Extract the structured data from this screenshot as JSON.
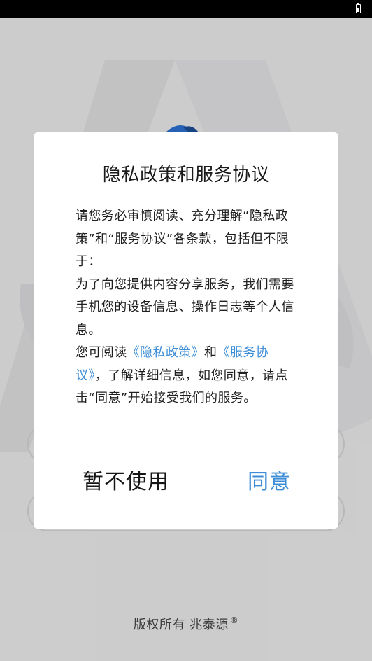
{
  "status_bar": {
    "battery_icon": "battery-icon"
  },
  "splash": {
    "copyright_text": "版权所有 兆泰源",
    "registered_mark": "®"
  },
  "dialog": {
    "title": "隐私政策和服务协议",
    "paragraph1": "请您务必审慎阅读、充分理解“隐私政策”和“服务协议”各条款，包括但不限于：",
    "paragraph2": "为了向您提供内容分享服务，我们需要手机您的设备信息、操作日志等个人信息。",
    "p3_prefix": "您可阅读",
    "privacy_link": "《隐私政策》",
    "p3_and": "和",
    "service_link": "《服务协议》",
    "p3_suffix": "，了解详细信息，如您同意，请点击“同意”开始接受我们的服务。",
    "decline_label": "暂不使用",
    "agree_label": "同意"
  },
  "colors": {
    "link": "#3c8dd6",
    "accent_blue": "#2c6fd0"
  }
}
